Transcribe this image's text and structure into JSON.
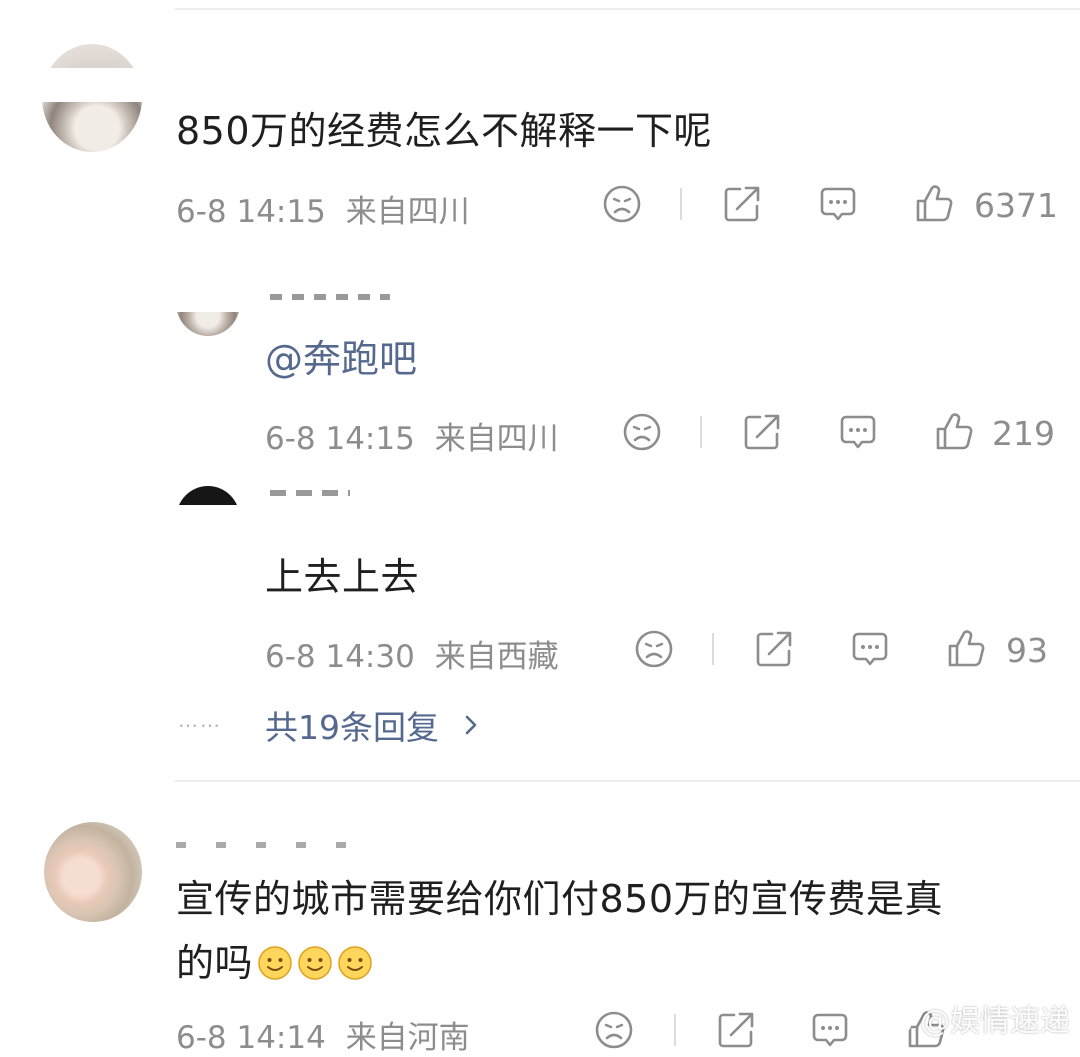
{
  "comments": [
    {
      "text": "850万的经费怎么不解释一下呢",
      "date": "6-8 14:15",
      "location": "来自四川",
      "likes": "6371",
      "replies": [
        {
          "text": "@奔跑吧",
          "date": "6-8 14:15",
          "location": "来自四川",
          "likes": "219"
        },
        {
          "text": "上去上去",
          "date": "6-8 14:30",
          "location": "来自西藏",
          "likes": "93"
        }
      ],
      "more_replies": "共19条回复",
      "more_dots": "……"
    },
    {
      "text_line1": "宣传的城市需要给你们付850万的宣传费是真",
      "text_line2": "的吗",
      "date": "6-8 14:14",
      "location": "来自河南"
    }
  ],
  "watermark": "@娱情速递",
  "colors": {
    "link": "#55698f",
    "meta": "#8d8d8d",
    "divider": "#ececec"
  }
}
